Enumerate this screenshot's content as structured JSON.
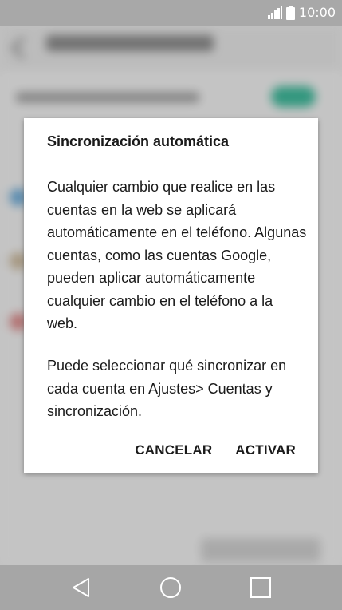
{
  "status_bar": {
    "time": "10:00",
    "icons": [
      "signal-icon",
      "battery-icon"
    ]
  },
  "dialog": {
    "title": "Sincronización automática",
    "body": "Cualquier cambio que realice en las cuentas en la web se aplicará automáticamente en el teléfono. Algunas cuentas, como las cuentas Google, pueden aplicar automáticamente cualquier cambio en el teléfono a la web.",
    "note": "Puede seleccionar qué sincronizar en cada cuenta en Ajustes> Cuentas y sincronización.",
    "cancel_label": "CANCELAR",
    "confirm_label": "ACTIVAR"
  },
  "nav_bar": {
    "icons": [
      "back-icon",
      "home-icon",
      "recents-icon"
    ]
  },
  "colors": {
    "status_bar": "#a8a8a8",
    "nav_bar": "#a6a6a6",
    "dialog_bg": "#ffffff",
    "text": "#1a1a1a",
    "toggle_accent": "#3fb99b"
  }
}
